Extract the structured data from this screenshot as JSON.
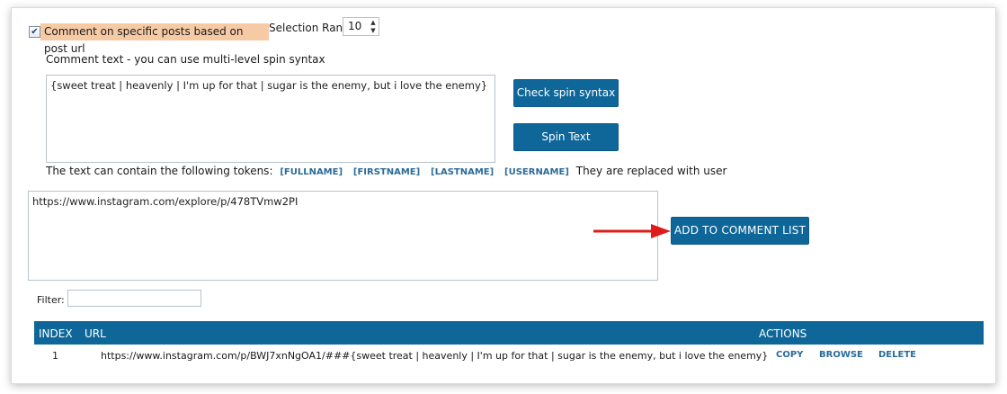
{
  "controls": {
    "checkbox_label": "Comment on specific posts based on post url",
    "selection_rank_label": "Selection Rank",
    "selection_rank_value": "10",
    "comment_caption": "Comment text - you can use multi-level spin syntax",
    "comment_text": "{sweet treat | heavenly | I'm up for that | sugar is the enemy, but i love the enemy}",
    "check_spin_label": "Check spin syntax",
    "spin_text_label": "Spin Text",
    "tokens_prefix": "The text can contain the following tokens:",
    "tokens": [
      "[FULLNAME]",
      "[FIRSTNAME]",
      "[LASTNAME]",
      "[USERNAME]"
    ],
    "tokens_suffix": "They are replaced with user",
    "url_text": "https://www.instagram.com/explore/p/478TVmw2PI",
    "add_button_label": "ADD TO COMMENT LIST",
    "filter_label": "Filter:",
    "filter_value": ""
  },
  "table": {
    "headers": {
      "index": "INDEX",
      "url": "URL",
      "actions": "ACTIONS"
    },
    "rows": [
      {
        "index": "1",
        "url": "https://www.instagram.com/p/BWJ7xnNgOA1/###{sweet treat | heavenly | I'm up for that | sugar is the enemy, but i love the enemy}",
        "copy": "COPY",
        "browse": "BROWSE",
        "delete": "DELETE"
      }
    ]
  },
  "colors": {
    "accent": "#0f6799",
    "highlight": "#f7caa6",
    "token_link": "#2c6b98",
    "arrow": "#e01b1b"
  },
  "icons": {
    "checkbox": "checkmark-icon",
    "spinner": "spinner-arrows-icon",
    "arrow": "right-arrow-icon"
  }
}
